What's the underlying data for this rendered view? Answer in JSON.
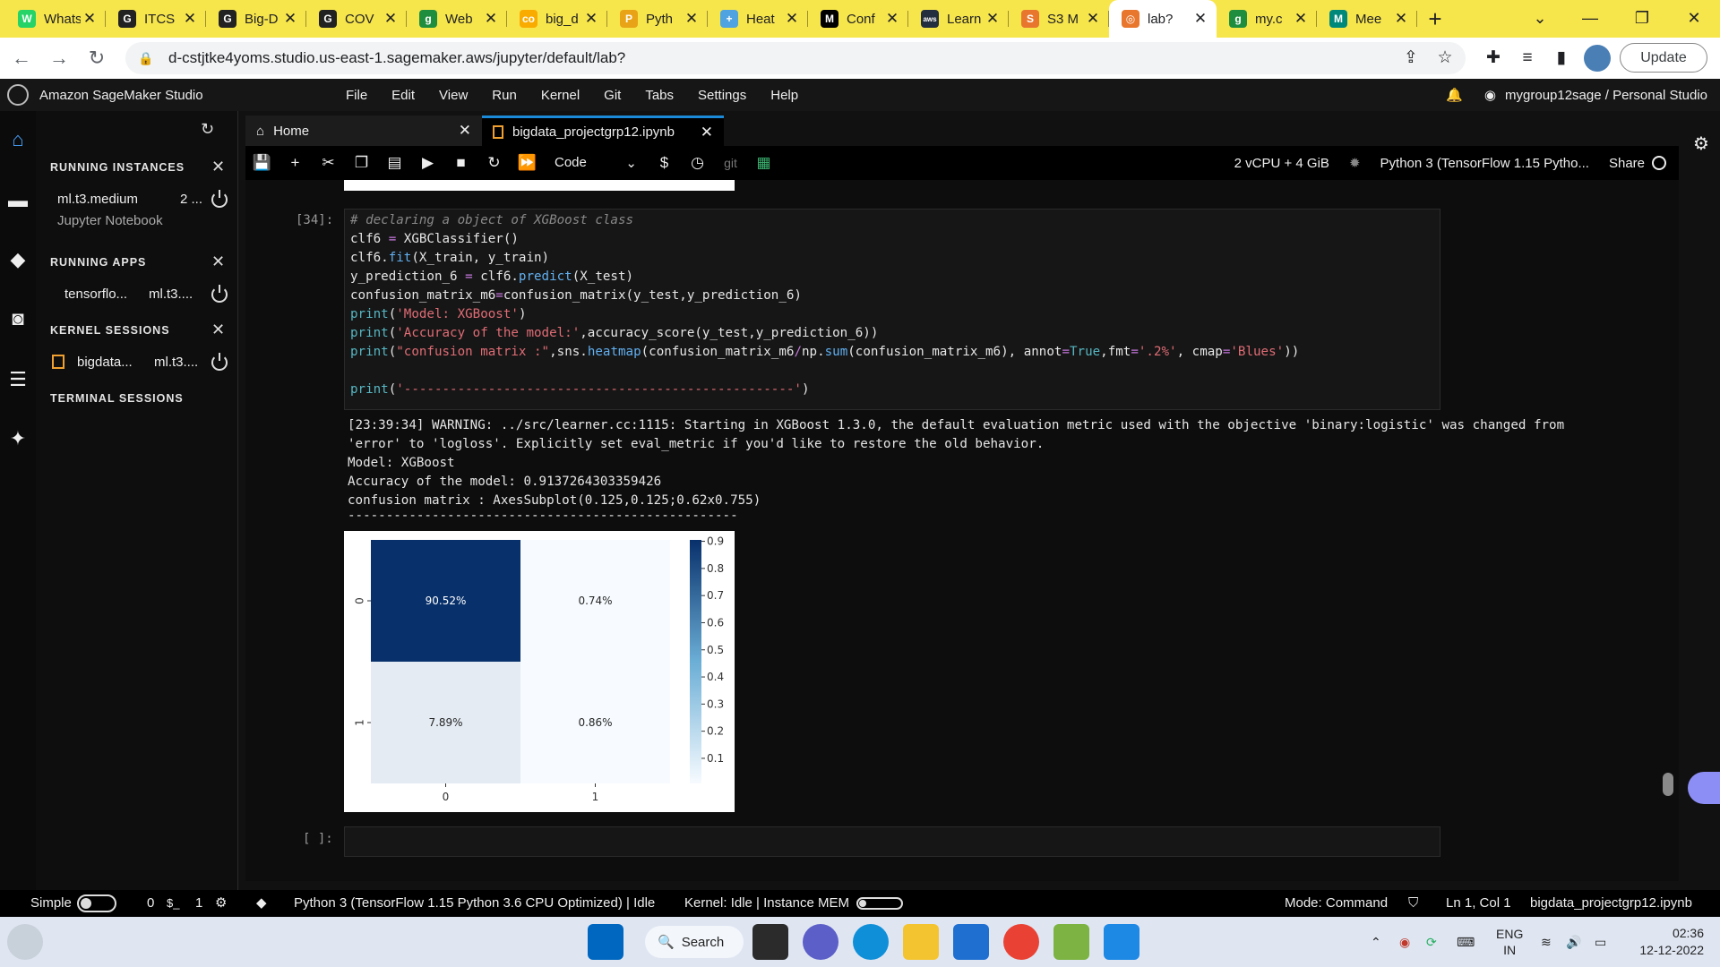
{
  "browser": {
    "tabs": [
      {
        "title": "WhatsApp",
        "icon": "whatsapp-icon",
        "color": "#25d366",
        "glyph": "W"
      },
      {
        "title": "ITCS",
        "icon": "github-icon",
        "color": "#222222",
        "glyph": "G"
      },
      {
        "title": "Big-D",
        "icon": "github-icon",
        "color": "#222222",
        "glyph": "G"
      },
      {
        "title": "COV",
        "icon": "github-icon",
        "color": "#222222",
        "glyph": "G"
      },
      {
        "title": "Web",
        "icon": "green-g-icon",
        "color": "#1e8e3e",
        "glyph": "g"
      },
      {
        "title": "big_d",
        "icon": "colab-icon",
        "color": "#f9ab00",
        "glyph": "co"
      },
      {
        "title": "Pyth",
        "icon": "python-icon",
        "color": "#e8a317",
        "glyph": "P"
      },
      {
        "title": "Heat",
        "icon": "plus-icon",
        "color": "#4fa3e0",
        "glyph": "+"
      },
      {
        "title": "Conf",
        "icon": "medium-icon",
        "color": "#000000",
        "glyph": "M"
      },
      {
        "title": "Learn",
        "icon": "aws-icon",
        "color": "#232f3e",
        "glyph": "aws"
      },
      {
        "title": "S3 M",
        "icon": "s3-icon",
        "color": "#e8762d",
        "glyph": "S"
      },
      {
        "title": "lab?",
        "icon": "sagemaker-icon",
        "color": "#e8762d",
        "glyph": "◎",
        "active": true
      },
      {
        "title": "my.c",
        "icon": "green-g-icon",
        "color": "#1e8e3e",
        "glyph": "g"
      },
      {
        "title": "Mee",
        "icon": "meet-icon",
        "color": "#00897b",
        "glyph": "M"
      }
    ],
    "url": "d-cstjtke4yoms.studio.us-east-1.sagemaker.aws/jupyter/default/lab?",
    "update_label": "Update"
  },
  "studio": {
    "brand": "Amazon SageMaker Studio",
    "menu": [
      "File",
      "Edit",
      "View",
      "Run",
      "Kernel",
      "Git",
      "Tabs",
      "Settings",
      "Help"
    ],
    "user": "mygroup12sage / Personal Studio"
  },
  "sidebar": {
    "running_instances": "RUNNING INSTANCES",
    "instance_name": "ml.t3.medium",
    "instance_count": "2 ...",
    "instance_sub": "Jupyter Notebook",
    "running_apps": "RUNNING APPS",
    "app_name": "tensorflo...",
    "app_instance": "ml.t3....",
    "kernel_sessions": "KERNEL SESSIONS",
    "kernel_name": "bigdata...",
    "kernel_instance": "ml.t3....",
    "terminal_sessions": "TERMINAL SESSIONS"
  },
  "doc_tabs": [
    {
      "label": "Home",
      "icon": "home-icon"
    },
    {
      "label": "bigdata_projectgrp12.ipynb",
      "icon": "notebook-icon",
      "active": true
    }
  ],
  "toolbar": {
    "cell_type": "Code",
    "resources": "2 vCPU + 4 GiB",
    "kernel": "Python 3 (TensorFlow 1.15 Pytho...",
    "share": "Share",
    "git": "git"
  },
  "cell": {
    "prompt": "[34]:",
    "empty_prompt": "[ ]:",
    "code": {
      "l1": "# declaring a object of XGBoost class",
      "l2a": "clf6 ",
      "l2b": "=",
      "l2c": " XGBClassifier()",
      "l3a": "clf6.",
      "l3b": "fit",
      "l3c": "(X_train, y_train)",
      "l4a": "y_prediction_6 ",
      "l4b": "=",
      "l4c": " clf6.",
      "l4d": "predict",
      "l4e": "(X_test)",
      "l5a": "confusion_matrix_m6",
      "l5b": "=",
      "l5c": "confusion_matrix(y_test,y_prediction_6)",
      "l6a": "print",
      "l6b": "(",
      "l6c": "'Model: XGBoost'",
      "l6d": ")",
      "l7a": "print",
      "l7b": "(",
      "l7c": "'Accuracy of the model:'",
      "l7d": ",accuracy_score(y_test,y_prediction_6))",
      "l8a": "print",
      "l8b": "(",
      "l8c": "\"confusion matrix :\"",
      "l8d": ",sns.",
      "l8e": "heatmap",
      "l8f": "(confusion_matrix_m6",
      "l8g": "/",
      "l8h": "np.",
      "l8i": "sum",
      "l8j": "(confusion_matrix_m6), annot",
      "l8k": "=",
      "l8l": "True",
      "l8m": ",fmt",
      "l8n": "=",
      "l8o": "'.2%'",
      "l8p": ", cmap",
      "l8q": "=",
      "l8r": "'Blues'",
      "l8s": "))",
      "l9a": "print",
      "l9b": "(",
      "l9c": "'---------------------------------------------------'",
      "l9d": ")"
    },
    "output": [
      "[23:39:34] WARNING: ../src/learner.cc:1115: Starting in XGBoost 1.3.0, the default evaluation metric used with the objective 'binary:logistic' was changed from",
      "'error' to 'logloss'. Explicitly set eval_metric if you'd like to restore the old behavior.",
      "Model: XGBoost",
      "Accuracy of the model: 0.9137264303359426",
      "confusion matrix : AxesSubplot(0.125,0.125;0.62x0.755)",
      "---------------------------------------------------"
    ]
  },
  "chart_data": {
    "type": "heatmap",
    "title": "",
    "xlabel": "",
    "ylabel": "",
    "x_ticks": [
      "0",
      "1"
    ],
    "y_ticks": [
      "0",
      "1"
    ],
    "values": [
      [
        0.9052,
        0.0074
      ],
      [
        0.0789,
        0.0086
      ]
    ],
    "labels": [
      [
        "90.52%",
        "0.74%"
      ],
      [
        "7.89%",
        "0.86%"
      ]
    ],
    "colorbar_ticks": [
      "0.9",
      "0.8",
      "0.7",
      "0.6",
      "0.5",
      "0.4",
      "0.3",
      "0.2",
      "0.1"
    ],
    "colorbar_range": [
      0.0074,
      0.9052
    ],
    "cmap": "Blues",
    "colors": {
      "low": "#f7fbff",
      "high": "#08306b"
    }
  },
  "statusbar": {
    "mode_label": "Simple",
    "count0": "0",
    "count1": "1",
    "kernel_info": "Python 3 (TensorFlow 1.15 Python 3.6 CPU Optimized) | Idle",
    "kernel_idle": "Kernel: Idle | Instance MEM",
    "mode": "Mode: Command",
    "position": "Ln 1, Col 1",
    "file": "bigdata_projectgrp12.ipynb"
  },
  "taskbar": {
    "search": "Search",
    "lang1": "ENG",
    "lang2": "IN",
    "time": "02:36",
    "date": "12-12-2022"
  }
}
